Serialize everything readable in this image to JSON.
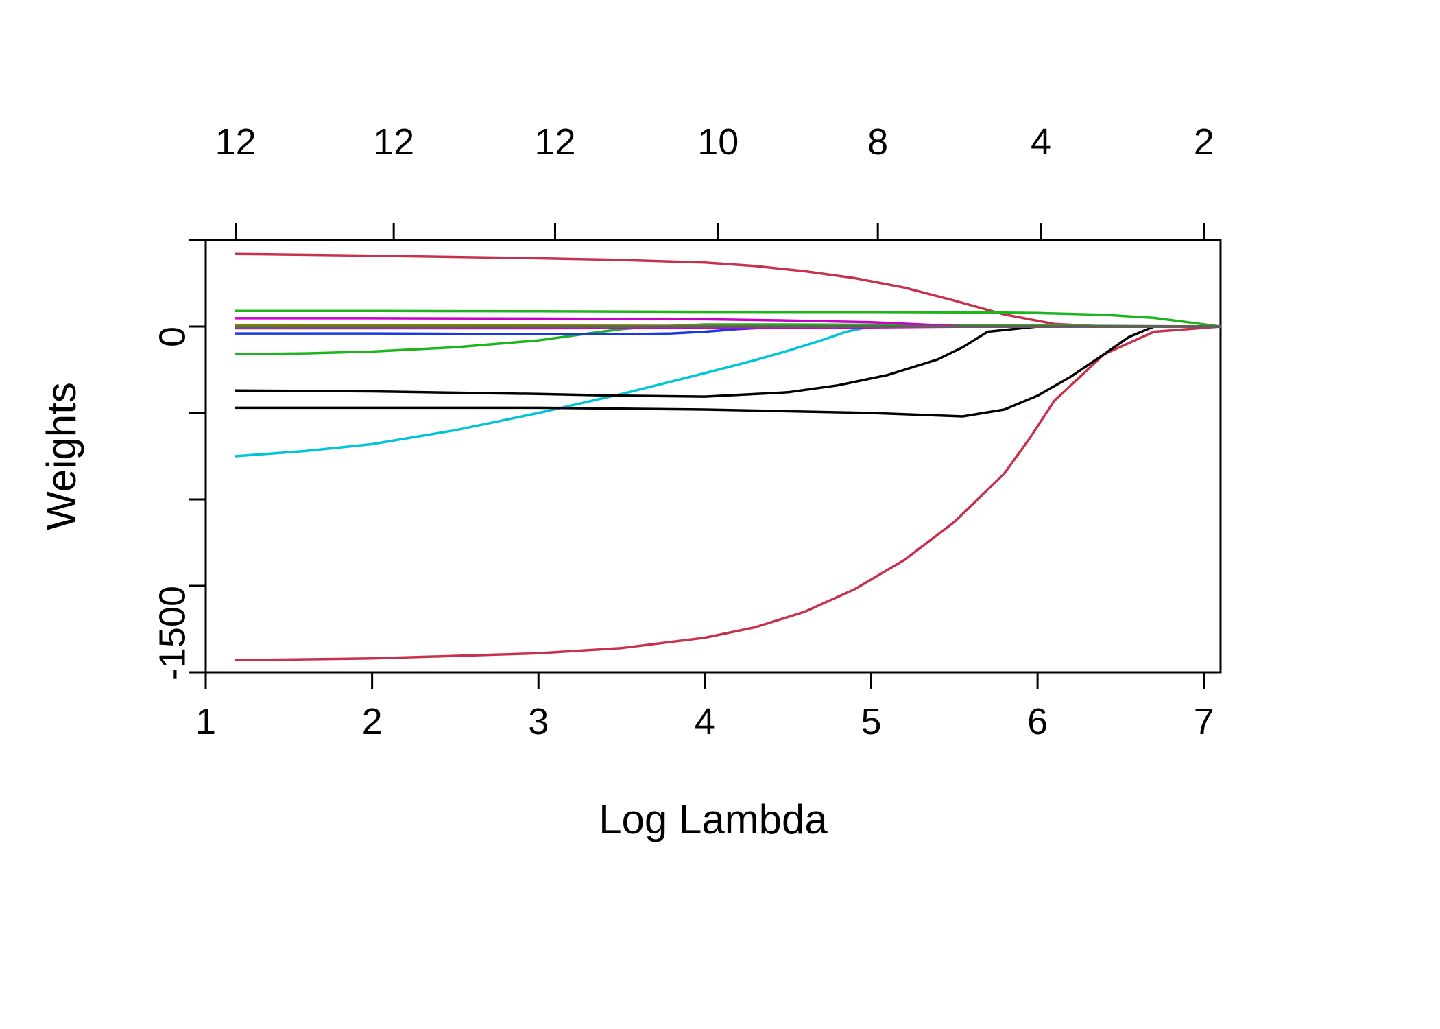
{
  "chart_data": {
    "type": "line",
    "title": "",
    "xlabel": "Log Lambda",
    "ylabel": "Weights",
    "xlim": [
      1,
      7.1
    ],
    "ylim": [
      -2000,
      500
    ],
    "x_ticks": [
      1,
      2,
      3,
      4,
      5,
      6,
      7
    ],
    "y_ticks": [
      -1500,
      0
    ],
    "y_minor_ticks": [
      -2000,
      -1000,
      -500,
      500
    ],
    "top_axis_labels": [
      {
        "x": 1.18,
        "label": "12"
      },
      {
        "x": 2.13,
        "label": "12"
      },
      {
        "x": 3.1,
        "label": "12"
      },
      {
        "x": 4.08,
        "label": "10"
      },
      {
        "x": 5.04,
        "label": "8"
      },
      {
        "x": 6.02,
        "label": "4"
      },
      {
        "x": 7.0,
        "label": "2"
      }
    ],
    "series": [
      {
        "name": "coef-red-top",
        "color": "#C8314B",
        "x": [
          1.18,
          2.0,
          3.0,
          3.5,
          4.0,
          4.3,
          4.6,
          4.9,
          5.2,
          5.5,
          5.8,
          6.1,
          6.4,
          6.7,
          7.1
        ],
        "y": [
          420,
          410,
          395,
          385,
          370,
          350,
          320,
          280,
          225,
          150,
          70,
          15,
          0,
          0,
          0
        ]
      },
      {
        "name": "coef-red-bottom",
        "color": "#C8314B",
        "x": [
          1.18,
          2.0,
          3.0,
          3.5,
          4.0,
          4.3,
          4.6,
          4.9,
          5.2,
          5.5,
          5.8,
          5.95,
          6.1,
          6.4,
          6.7,
          7.1
        ],
        "y": [
          -1930,
          -1920,
          -1890,
          -1860,
          -1800,
          -1740,
          -1650,
          -1520,
          -1350,
          -1130,
          -850,
          -650,
          -430,
          -160,
          -30,
          0
        ]
      },
      {
        "name": "coef-green-top",
        "color": "#1DB41D",
        "x": [
          1.18,
          2.0,
          3.0,
          4.0,
          5.0,
          5.6,
          6.0,
          6.4,
          6.7,
          6.9,
          7.1
        ],
        "y": [
          90,
          90,
          88,
          85,
          84,
          82,
          78,
          68,
          50,
          25,
          0
        ]
      },
      {
        "name": "coef-green-dip",
        "color": "#1DB41D",
        "x": [
          1.18,
          1.6,
          2.0,
          2.5,
          3.0,
          3.3,
          3.5,
          3.7,
          4.0,
          4.5,
          5.0,
          7.1
        ],
        "y": [
          -160,
          -155,
          -145,
          -120,
          -80,
          -40,
          -15,
          0,
          12,
          12,
          10,
          0
        ]
      },
      {
        "name": "coef-cyan",
        "color": "#00C4D7",
        "x": [
          1.18,
          1.6,
          2.0,
          2.5,
          3.0,
          3.5,
          4.0,
          4.3,
          4.5,
          4.7,
          4.85,
          5.0,
          7.1
        ],
        "y": [
          -750,
          -720,
          -680,
          -600,
          -500,
          -390,
          -270,
          -195,
          -140,
          -80,
          -30,
          0,
          0
        ]
      },
      {
        "name": "coef-black-upper",
        "color": "#000000",
        "x": [
          1.18,
          2.0,
          3.0,
          3.5,
          4.0,
          4.5,
          4.8,
          5.1,
          5.4,
          5.55,
          5.7,
          6.0,
          6.3,
          6.5,
          6.6,
          7.1
        ],
        "y": [
          -370,
          -375,
          -390,
          -400,
          -405,
          -380,
          -340,
          -280,
          -190,
          -120,
          -30,
          0,
          0,
          0,
          0,
          0
        ]
      },
      {
        "name": "coef-black-lower",
        "color": "#000000",
        "x": [
          1.18,
          2.0,
          3.0,
          3.5,
          4.0,
          4.5,
          5.0,
          5.55,
          5.8,
          6.0,
          6.2,
          6.4,
          6.55,
          6.7,
          7.1
        ],
        "y": [
          -470,
          -470,
          -470,
          -475,
          -480,
          -490,
          -500,
          -520,
          -480,
          -400,
          -290,
          -160,
          -60,
          0,
          0
        ]
      },
      {
        "name": "coef-blue",
        "color": "#1A3AE0",
        "x": [
          1.18,
          2.0,
          3.0,
          3.5,
          3.8,
          4.0,
          4.2,
          4.5,
          5.0,
          7.1
        ],
        "y": [
          -40,
          -40,
          -45,
          -45,
          -40,
          -30,
          -15,
          0,
          0,
          0
        ]
      },
      {
        "name": "coef-magenta-high",
        "color": "#C800C8",
        "x": [
          1.18,
          2.0,
          3.0,
          3.5,
          4.0,
          4.5,
          5.0,
          5.3,
          5.5,
          5.6,
          7.1
        ],
        "y": [
          48,
          48,
          46,
          44,
          42,
          35,
          25,
          12,
          3,
          0,
          0
        ]
      },
      {
        "name": "coef-magenta-low",
        "color": "#C800C8",
        "x": [
          1.18,
          2.0,
          3.0,
          4.0,
          5.0,
          5.5,
          5.6,
          7.1
        ],
        "y": [
          -10,
          -10,
          -10,
          -8,
          -5,
          -1,
          0,
          0
        ]
      },
      {
        "name": "coef-near-zero-a",
        "color": "#808000",
        "x": [
          1.18,
          3.0,
          4.0,
          4.5,
          7.1
        ],
        "y": [
          6,
          5,
          3,
          0,
          0
        ]
      },
      {
        "name": "coef-near-zero-b",
        "color": "#606060",
        "x": [
          1.18,
          2.5,
          3.5,
          4.0,
          7.1
        ],
        "y": [
          -4,
          -3,
          -1,
          0,
          0
        ]
      }
    ]
  }
}
